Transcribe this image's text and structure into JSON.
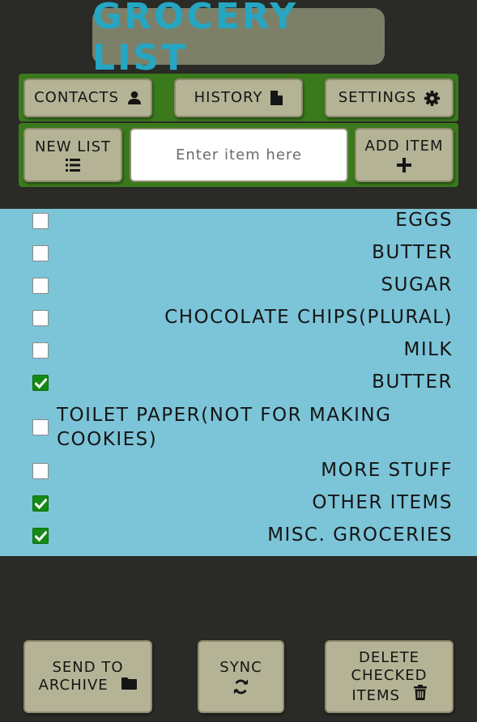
{
  "header": {
    "title": "GROCERY LIST"
  },
  "nav": {
    "contacts_label": "CONTACTS",
    "history_label": "HISTORY",
    "settings_label": "SETTINGS"
  },
  "toolbar": {
    "new_list_label": "NEW LIST",
    "item_input_placeholder": "Enter item here",
    "item_input_value": "",
    "add_item_label": "ADD ITEM"
  },
  "list": {
    "items": [
      {
        "label": "EGGS",
        "checked": false
      },
      {
        "label": "BUTTER",
        "checked": false
      },
      {
        "label": "SUGAR",
        "checked": false
      },
      {
        "label": "CHOCOLATE CHIPS(PLURAL)",
        "checked": false
      },
      {
        "label": "MILK",
        "checked": false
      },
      {
        "label": "BUTTER",
        "checked": true
      },
      {
        "label": "TOILET PAPER(NOT FOR MAKING COOKIES)",
        "checked": false
      },
      {
        "label": "MORE STUFF",
        "checked": false
      },
      {
        "label": "OTHER ITEMS",
        "checked": true
      },
      {
        "label": "MISC. GROCERIES",
        "checked": true
      }
    ]
  },
  "footer": {
    "send_to_archive_label": "SEND TO ARCHIVE",
    "sync_label": "SYNC",
    "delete_checked_label": "DELETE CHECKED ITEMS"
  },
  "icons": {
    "contacts": "user-icon",
    "history": "file-icon",
    "settings": "gear-icon",
    "new_list": "list-icon",
    "add_item": "plus-icon",
    "archive": "folder-icon",
    "sync": "sync-icon",
    "delete": "trash-icon",
    "check": "checkmark-icon"
  },
  "colors": {
    "background": "#2a2a26",
    "title_box": "#7c8069",
    "title_text": "#25a6c3",
    "toolbar_bar": "#3a7a1c",
    "button": "#b4b395",
    "list_background": "#7cc4d8",
    "checkbox_checked": "#148a14"
  }
}
